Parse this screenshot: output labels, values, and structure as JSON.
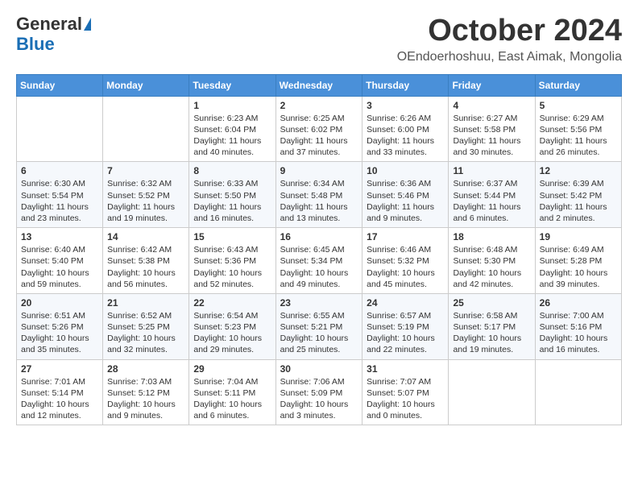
{
  "header": {
    "logo_general": "General",
    "logo_blue": "Blue",
    "month_title": "October 2024",
    "location": "OEndoerhoshuu, East Aimak, Mongolia"
  },
  "days_of_week": [
    "Sunday",
    "Monday",
    "Tuesday",
    "Wednesday",
    "Thursday",
    "Friday",
    "Saturday"
  ],
  "weeks": [
    [
      {
        "day": "",
        "info": ""
      },
      {
        "day": "",
        "info": ""
      },
      {
        "day": "1",
        "info": "Sunrise: 6:23 AM\nSunset: 6:04 PM\nDaylight: 11 hours and 40 minutes."
      },
      {
        "day": "2",
        "info": "Sunrise: 6:25 AM\nSunset: 6:02 PM\nDaylight: 11 hours and 37 minutes."
      },
      {
        "day": "3",
        "info": "Sunrise: 6:26 AM\nSunset: 6:00 PM\nDaylight: 11 hours and 33 minutes."
      },
      {
        "day": "4",
        "info": "Sunrise: 6:27 AM\nSunset: 5:58 PM\nDaylight: 11 hours and 30 minutes."
      },
      {
        "day": "5",
        "info": "Sunrise: 6:29 AM\nSunset: 5:56 PM\nDaylight: 11 hours and 26 minutes."
      }
    ],
    [
      {
        "day": "6",
        "info": "Sunrise: 6:30 AM\nSunset: 5:54 PM\nDaylight: 11 hours and 23 minutes."
      },
      {
        "day": "7",
        "info": "Sunrise: 6:32 AM\nSunset: 5:52 PM\nDaylight: 11 hours and 19 minutes."
      },
      {
        "day": "8",
        "info": "Sunrise: 6:33 AM\nSunset: 5:50 PM\nDaylight: 11 hours and 16 minutes."
      },
      {
        "day": "9",
        "info": "Sunrise: 6:34 AM\nSunset: 5:48 PM\nDaylight: 11 hours and 13 minutes."
      },
      {
        "day": "10",
        "info": "Sunrise: 6:36 AM\nSunset: 5:46 PM\nDaylight: 11 hours and 9 minutes."
      },
      {
        "day": "11",
        "info": "Sunrise: 6:37 AM\nSunset: 5:44 PM\nDaylight: 11 hours and 6 minutes."
      },
      {
        "day": "12",
        "info": "Sunrise: 6:39 AM\nSunset: 5:42 PM\nDaylight: 11 hours and 2 minutes."
      }
    ],
    [
      {
        "day": "13",
        "info": "Sunrise: 6:40 AM\nSunset: 5:40 PM\nDaylight: 10 hours and 59 minutes."
      },
      {
        "day": "14",
        "info": "Sunrise: 6:42 AM\nSunset: 5:38 PM\nDaylight: 10 hours and 56 minutes."
      },
      {
        "day": "15",
        "info": "Sunrise: 6:43 AM\nSunset: 5:36 PM\nDaylight: 10 hours and 52 minutes."
      },
      {
        "day": "16",
        "info": "Sunrise: 6:45 AM\nSunset: 5:34 PM\nDaylight: 10 hours and 49 minutes."
      },
      {
        "day": "17",
        "info": "Sunrise: 6:46 AM\nSunset: 5:32 PM\nDaylight: 10 hours and 45 minutes."
      },
      {
        "day": "18",
        "info": "Sunrise: 6:48 AM\nSunset: 5:30 PM\nDaylight: 10 hours and 42 minutes."
      },
      {
        "day": "19",
        "info": "Sunrise: 6:49 AM\nSunset: 5:28 PM\nDaylight: 10 hours and 39 minutes."
      }
    ],
    [
      {
        "day": "20",
        "info": "Sunrise: 6:51 AM\nSunset: 5:26 PM\nDaylight: 10 hours and 35 minutes."
      },
      {
        "day": "21",
        "info": "Sunrise: 6:52 AM\nSunset: 5:25 PM\nDaylight: 10 hours and 32 minutes."
      },
      {
        "day": "22",
        "info": "Sunrise: 6:54 AM\nSunset: 5:23 PM\nDaylight: 10 hours and 29 minutes."
      },
      {
        "day": "23",
        "info": "Sunrise: 6:55 AM\nSunset: 5:21 PM\nDaylight: 10 hours and 25 minutes."
      },
      {
        "day": "24",
        "info": "Sunrise: 6:57 AM\nSunset: 5:19 PM\nDaylight: 10 hours and 22 minutes."
      },
      {
        "day": "25",
        "info": "Sunrise: 6:58 AM\nSunset: 5:17 PM\nDaylight: 10 hours and 19 minutes."
      },
      {
        "day": "26",
        "info": "Sunrise: 7:00 AM\nSunset: 5:16 PM\nDaylight: 10 hours and 16 minutes."
      }
    ],
    [
      {
        "day": "27",
        "info": "Sunrise: 7:01 AM\nSunset: 5:14 PM\nDaylight: 10 hours and 12 minutes."
      },
      {
        "day": "28",
        "info": "Sunrise: 7:03 AM\nSunset: 5:12 PM\nDaylight: 10 hours and 9 minutes."
      },
      {
        "day": "29",
        "info": "Sunrise: 7:04 AM\nSunset: 5:11 PM\nDaylight: 10 hours and 6 minutes."
      },
      {
        "day": "30",
        "info": "Sunrise: 7:06 AM\nSunset: 5:09 PM\nDaylight: 10 hours and 3 minutes."
      },
      {
        "day": "31",
        "info": "Sunrise: 7:07 AM\nSunset: 5:07 PM\nDaylight: 10 hours and 0 minutes."
      },
      {
        "day": "",
        "info": ""
      },
      {
        "day": "",
        "info": ""
      }
    ]
  ]
}
